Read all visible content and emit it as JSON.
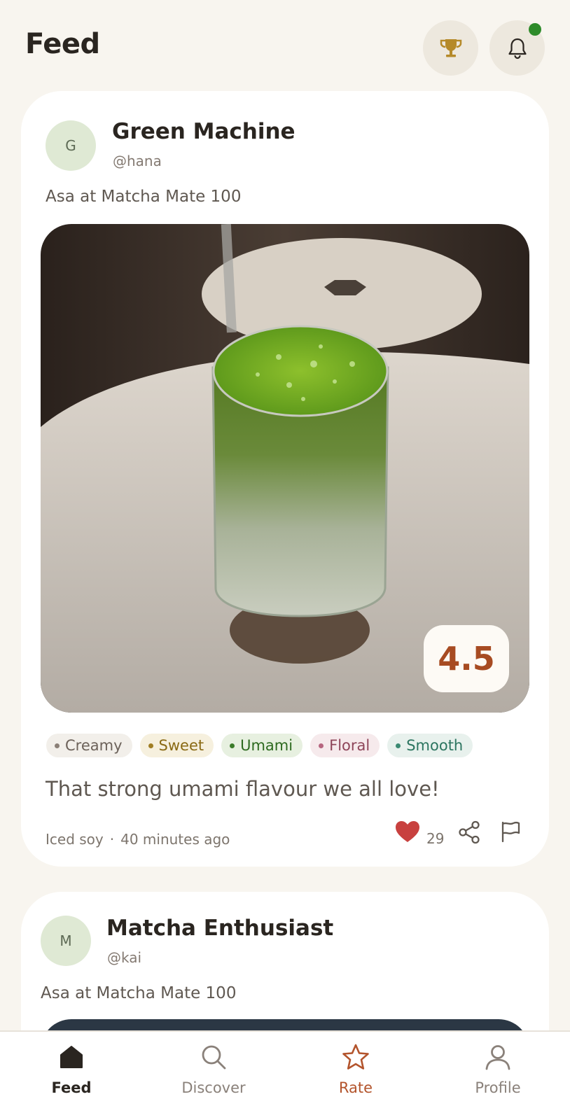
{
  "header": {
    "title": "Feed",
    "trophy_icon": "trophy-icon",
    "bell_icon": "bell-icon",
    "has_notification": true
  },
  "posts": [
    {
      "avatar_initial": "G",
      "name": "Green Machine",
      "handle": "@hana",
      "subtitle": "Asa at Matcha Mate 100",
      "rating": "4.5",
      "tags": [
        "Creamy",
        "Sweet",
        "Umami",
        "Floral",
        "Smooth"
      ],
      "review": "That strong umami flavour we all love!",
      "milk": "Iced soy",
      "separator": "·",
      "time": "40 minutes ago",
      "likes": "29",
      "liked": true
    },
    {
      "avatar_initial": "M",
      "name": "Matcha Enthusiast",
      "handle": "@kai",
      "subtitle": "Asa at Matcha Mate 100"
    }
  ],
  "nav": {
    "items": [
      {
        "label": "Feed",
        "icon": "home-icon",
        "active": true
      },
      {
        "label": "Discover",
        "icon": "search-icon",
        "active": false
      },
      {
        "label": "Rate",
        "icon": "star-icon",
        "active": false
      },
      {
        "label": "Profile",
        "icon": "person-icon",
        "active": false
      }
    ]
  },
  "colors": {
    "background": "#f8f5ef",
    "accent": "#b3542c",
    "rating": "#a74b22",
    "like": "#c8413f",
    "notification": "#2e8b2a"
  }
}
